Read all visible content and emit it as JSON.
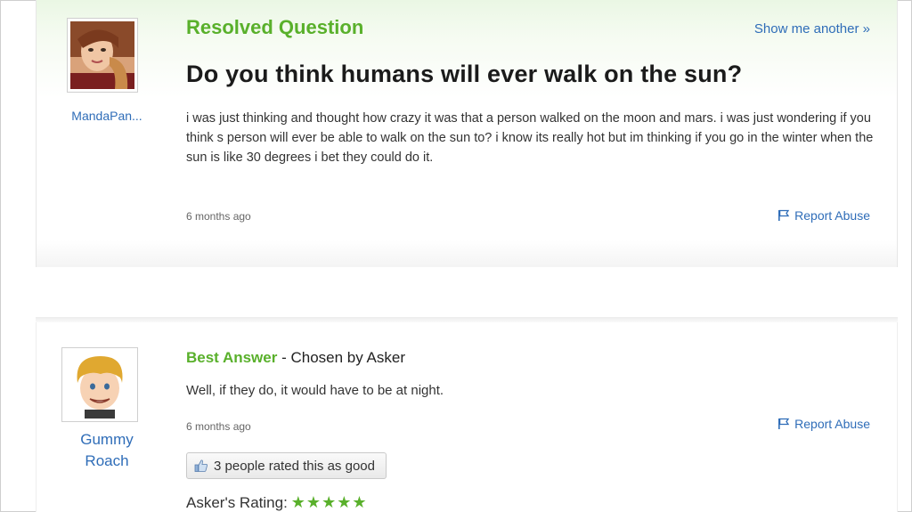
{
  "question": {
    "asker_name": "MandaPan...",
    "status_label": "Resolved Question",
    "show_another_label": "Show me another »",
    "title": "Do you think humans will ever walk on the sun?",
    "body": "i was just thinking and thought how crazy it was that a person walked on the moon and mars. i was just wondering if you think s person will ever be able to walk on the sun to? i know its really hot but im thinking if you go in the winter when the sun is like 30 degrees i bet they could do it.",
    "time_ago": "6 months ago",
    "report_label": "Report Abuse"
  },
  "answer": {
    "answerer_name": "Gummy Roach",
    "best_label": "Best Answer",
    "chosen_by": " - Chosen by Asker",
    "body": "Well, if they do, it would have to be at night.",
    "time_ago": "6 months ago",
    "report_label": "Report Abuse",
    "rating_text": "3 people rated this as good",
    "askers_rating_label": "Asker's Rating:",
    "askers_rating_stars": "★★★★★",
    "askers_rating_value": 5
  },
  "colors": {
    "accent_green": "#59b02b",
    "link_blue": "#2f6db8"
  },
  "icons": {
    "flag": "flag-icon",
    "thumb": "thumbs-up-icon"
  }
}
